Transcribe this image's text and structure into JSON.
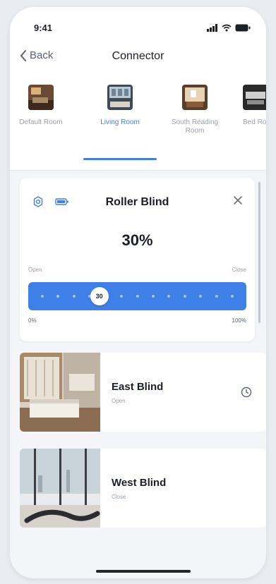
{
  "status_bar": {
    "time": "9:41"
  },
  "nav": {
    "back_label": "Back",
    "title": "Connector"
  },
  "rooms": [
    {
      "label": "Default Room",
      "active": false
    },
    {
      "label": "Living Room",
      "active": true
    },
    {
      "label": "South Reading Room",
      "active": false
    },
    {
      "label": "Bed Room",
      "active": false
    }
  ],
  "blind_control": {
    "title": "Roller Blind",
    "percent_label": "30%",
    "open_label": "Open",
    "close_label": "Close",
    "slider_value": 30,
    "knob_label": "30",
    "min_label": "0%",
    "max_label": "100%"
  },
  "devices": [
    {
      "name": "East Blind",
      "state": "Open"
    },
    {
      "name": "West Blind",
      "state": "Close"
    }
  ],
  "colors": {
    "accent": "#3f7fe8",
    "background": "#f3f5f8",
    "card": "#ffffff",
    "text": "#1c1f26"
  }
}
